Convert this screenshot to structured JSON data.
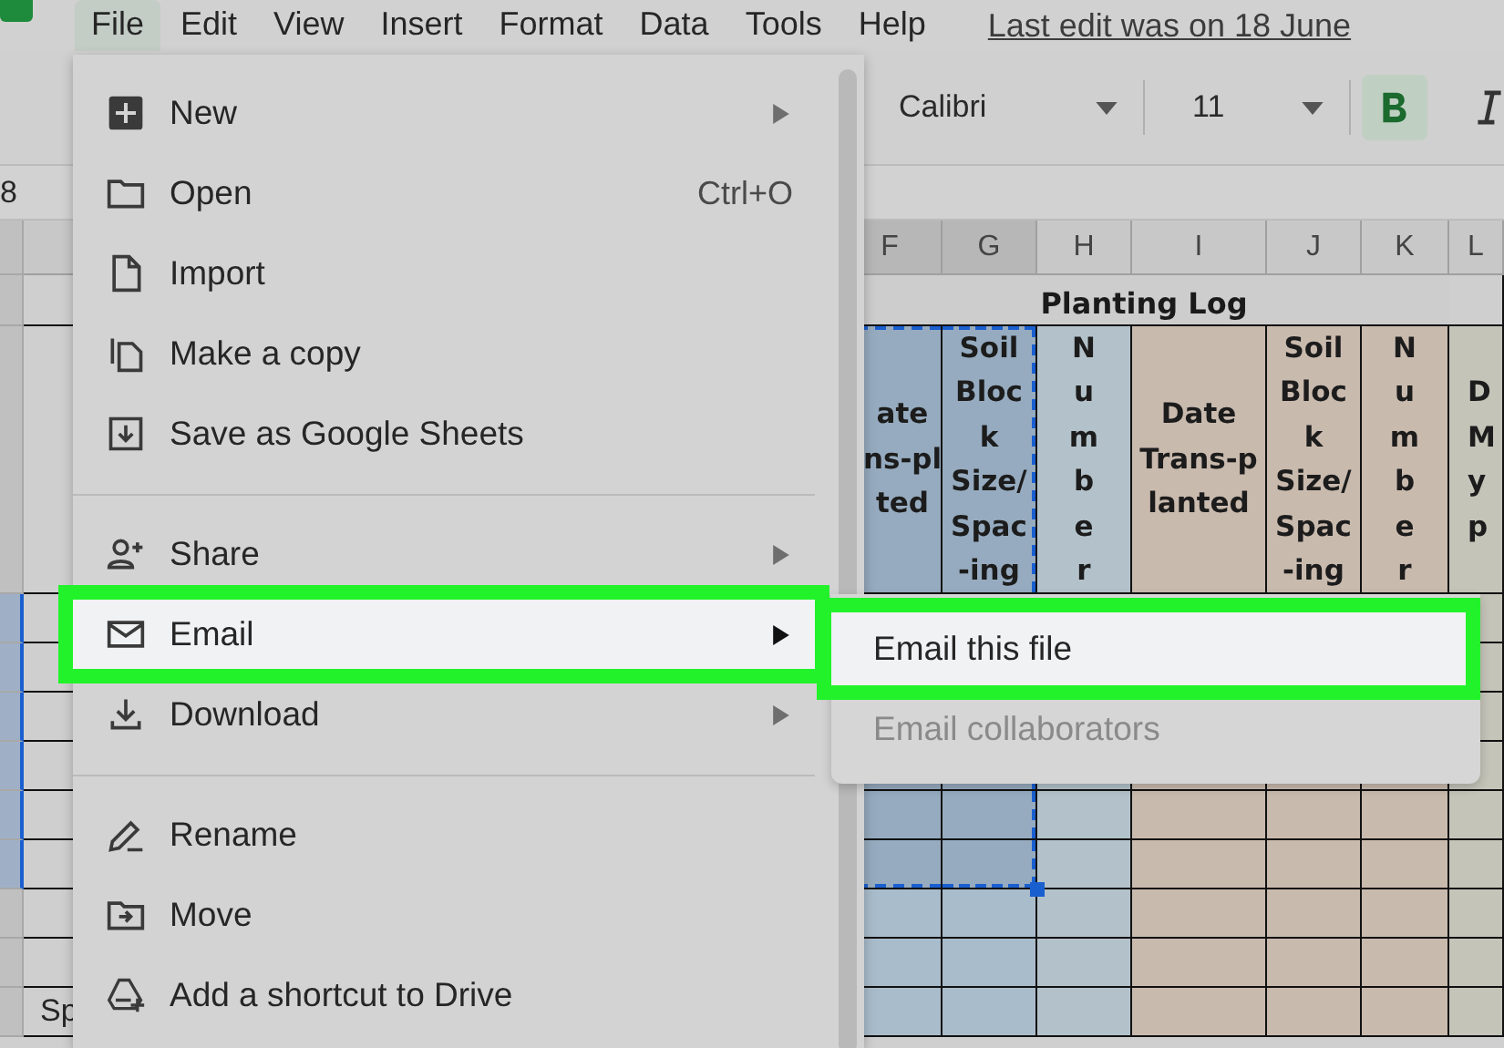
{
  "menubar": {
    "items": [
      {
        "label": "File",
        "selected": true
      },
      {
        "label": "Edit",
        "selected": false
      },
      {
        "label": "View",
        "selected": false
      },
      {
        "label": "Insert",
        "selected": false
      },
      {
        "label": "Format",
        "selected": false
      },
      {
        "label": "Data",
        "selected": false
      },
      {
        "label": "Tools",
        "selected": false
      },
      {
        "label": "Help",
        "selected": false
      }
    ],
    "last_edit": "Last edit was on 18 June"
  },
  "toolbar": {
    "font": "Calibri",
    "size": "11",
    "bold": true,
    "italic": false
  },
  "name_box": "8",
  "sheet": {
    "title": "Planting Log",
    "columns": [
      {
        "letter": "F",
        "selected": true,
        "color": "#a9bccb",
        "header": [
          "ate",
          "ns-pl",
          "ted"
        ]
      },
      {
        "letter": "G",
        "selected": true,
        "color": "#a9bccb",
        "header": [
          "Soil",
          "Bloc",
          "k",
          "Size/",
          "Spac",
          "-ing"
        ]
      },
      {
        "letter": "H",
        "selected": false,
        "color": "#b3c2ca",
        "header": [
          "N",
          "u",
          "m",
          "b",
          "e",
          "r"
        ]
      },
      {
        "letter": "I",
        "selected": false,
        "color": "#c9baae",
        "header": [
          "Date",
          "Trans-p",
          "lanted"
        ]
      },
      {
        "letter": "J",
        "selected": false,
        "color": "#c9baae",
        "header": [
          "Soil",
          "Bloc",
          "k",
          "Size/",
          "Spac",
          "-ing"
        ]
      },
      {
        "letter": "K",
        "selected": false,
        "color": "#c9baae",
        "header": [
          "N",
          "u",
          "m",
          "b",
          "e",
          "r"
        ]
      },
      {
        "letter": "L",
        "selected": false,
        "color": "#c4c4b9",
        "header": [
          "D",
          "M",
          "y",
          "p"
        ]
      }
    ],
    "rows": [
      {
        "selected": true
      },
      {
        "selected": true
      },
      {
        "selected": true
      },
      {
        "selected": true
      },
      {
        "selected": true
      },
      {
        "selected": true
      },
      {
        "selected": false
      },
      {
        "selected": false
      },
      {
        "selected": false,
        "label": "Sp"
      }
    ]
  },
  "file_menu": {
    "items": [
      {
        "kind": "item",
        "label": "New",
        "submenu": true,
        "highlighted": false
      },
      {
        "kind": "item",
        "label": "Open",
        "shortcut": "Ctrl+O",
        "submenu": false,
        "highlighted": false
      },
      {
        "kind": "item",
        "label": "Import",
        "submenu": false,
        "highlighted": false
      },
      {
        "kind": "item",
        "label": "Make a copy",
        "submenu": false,
        "highlighted": false
      },
      {
        "kind": "item",
        "label": "Save as Google Sheets",
        "submenu": false,
        "highlighted": false
      },
      {
        "kind": "divider"
      },
      {
        "kind": "item",
        "label": "Share",
        "submenu": true,
        "highlighted": false
      },
      {
        "kind": "item",
        "label": "Email",
        "submenu": true,
        "highlighted": true
      },
      {
        "kind": "item",
        "label": "Download",
        "submenu": true,
        "highlighted": false
      },
      {
        "kind": "divider"
      },
      {
        "kind": "item",
        "label": "Rename",
        "submenu": false,
        "highlighted": false
      },
      {
        "kind": "item",
        "label": "Move",
        "submenu": false,
        "highlighted": false
      },
      {
        "kind": "item",
        "label": "Add a shortcut to Drive",
        "submenu": false,
        "highlighted": false
      }
    ]
  },
  "email_submenu": {
    "items": [
      {
        "label": "Email this file",
        "highlighted": true,
        "disabled": false
      },
      {
        "label": "Email collaborators",
        "highlighted": false,
        "disabled": true
      }
    ]
  }
}
